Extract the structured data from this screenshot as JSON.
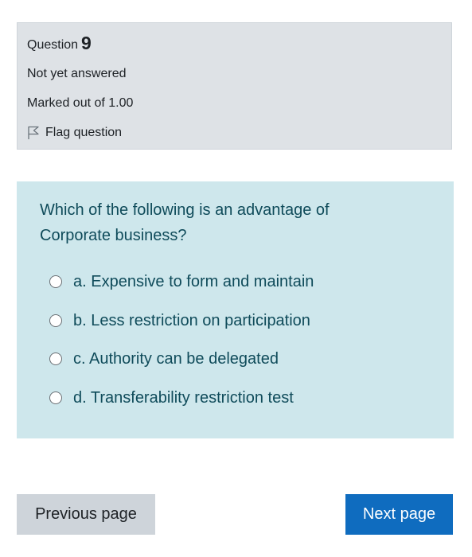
{
  "info": {
    "question_word": "Question",
    "question_number": "9",
    "status": "Not yet answered",
    "marks": "Marked out of 1.00",
    "flag_label": "Flag question"
  },
  "question": {
    "text": "Which of the following is an advantage of Corporate business?",
    "answers": [
      {
        "label": "a. Expensive to form and maintain",
        "selected": false
      },
      {
        "label": "b. Less restriction on participation",
        "selected": false
      },
      {
        "label": "c. Authority can be delegated",
        "selected": false
      },
      {
        "label": "d. Transferability restriction test",
        "selected": false
      }
    ]
  },
  "nav": {
    "previous_label": "Previous page",
    "next_label": "Next page"
  },
  "colors": {
    "info_bg": "#dee2e6",
    "content_bg": "#cee7ec",
    "content_text": "#0f4b5a",
    "next_button": "#0f6cbf",
    "previous_button": "#ced4da"
  },
  "icons": {
    "flag": "flag-icon",
    "radio": "radio-unchecked-icon"
  }
}
